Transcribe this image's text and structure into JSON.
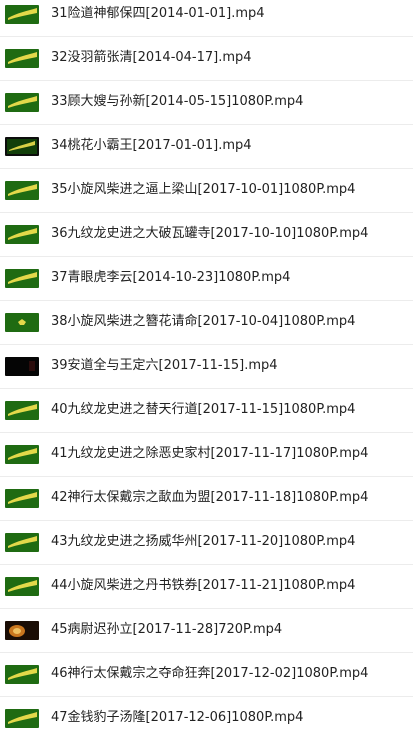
{
  "files": [
    {
      "name": "31险道神郁保四[2014-01-01].mp4",
      "thumbnail": "green-banner-thumbnail"
    },
    {
      "name": "32没羽箭张清[2014-04-17].mp4",
      "thumbnail": "green-banner-thumbnail"
    },
    {
      "name": "33顾大嫂与孙新[2014-05-15]1080P.mp4",
      "thumbnail": "green-banner-thumbnail"
    },
    {
      "name": "34桃花小霸王[2017-01-01].mp4",
      "thumbnail": "dark-green-banner-thumbnail"
    },
    {
      "name": "35小旋风柴进之逼上梁山[2017-10-01]1080P.mp4",
      "thumbnail": "green-banner-thumbnail"
    },
    {
      "name": "36九纹龙史进之大破瓦罐寺[2017-10-10]1080P.mp4",
      "thumbnail": "green-banner-thumbnail"
    },
    {
      "name": "37青眼虎李云[2014-10-23]1080P.mp4",
      "thumbnail": "green-banner-thumbnail"
    },
    {
      "name": "38小旋风柴进之簪花请命[2017-10-04]1080P.mp4",
      "thumbnail": "green-logo-thumbnail"
    },
    {
      "name": "39安道全与王定六[2017-11-15].mp4",
      "thumbnail": "black-frame-thumbnail"
    },
    {
      "name": "40九纹龙史进之替天行道[2017-11-15]1080P.mp4",
      "thumbnail": "green-banner-thumbnail"
    },
    {
      "name": "41九纹龙史进之除恶史家村[2017-11-17]1080P.mp4",
      "thumbnail": "green-banner-thumbnail"
    },
    {
      "name": "42神行太保戴宗之歃血为盟[2017-11-18]1080P.mp4",
      "thumbnail": "green-banner-thumbnail"
    },
    {
      "name": "43九纹龙史进之扬威华州[2017-11-20]1080P.mp4",
      "thumbnail": "green-banner-thumbnail"
    },
    {
      "name": "44小旋风柴进之丹书铁券[2017-11-21]1080P.mp4",
      "thumbnail": "green-banner-thumbnail"
    },
    {
      "name": "45病尉迟孙立[2017-11-28]720P.mp4",
      "thumbnail": "dark-fire-thumbnail"
    },
    {
      "name": "46神行太保戴宗之夺命狂奔[2017-12-02]1080P.mp4",
      "thumbnail": "green-banner-thumbnail"
    },
    {
      "name": "47金钱豹子汤隆[2017-12-06]1080P.mp4",
      "thumbnail": "green-banner-thumbnail"
    }
  ],
  "colors": {
    "thumbnail_green": "#1f6b12",
    "thumbnail_dark_green": "#123f0a",
    "thumbnail_yellow": "#e3d84a",
    "thumbnail_black": "#050505",
    "thumbnail_fire": "#c9761e",
    "text": "#222222",
    "divider": "#ececec"
  }
}
